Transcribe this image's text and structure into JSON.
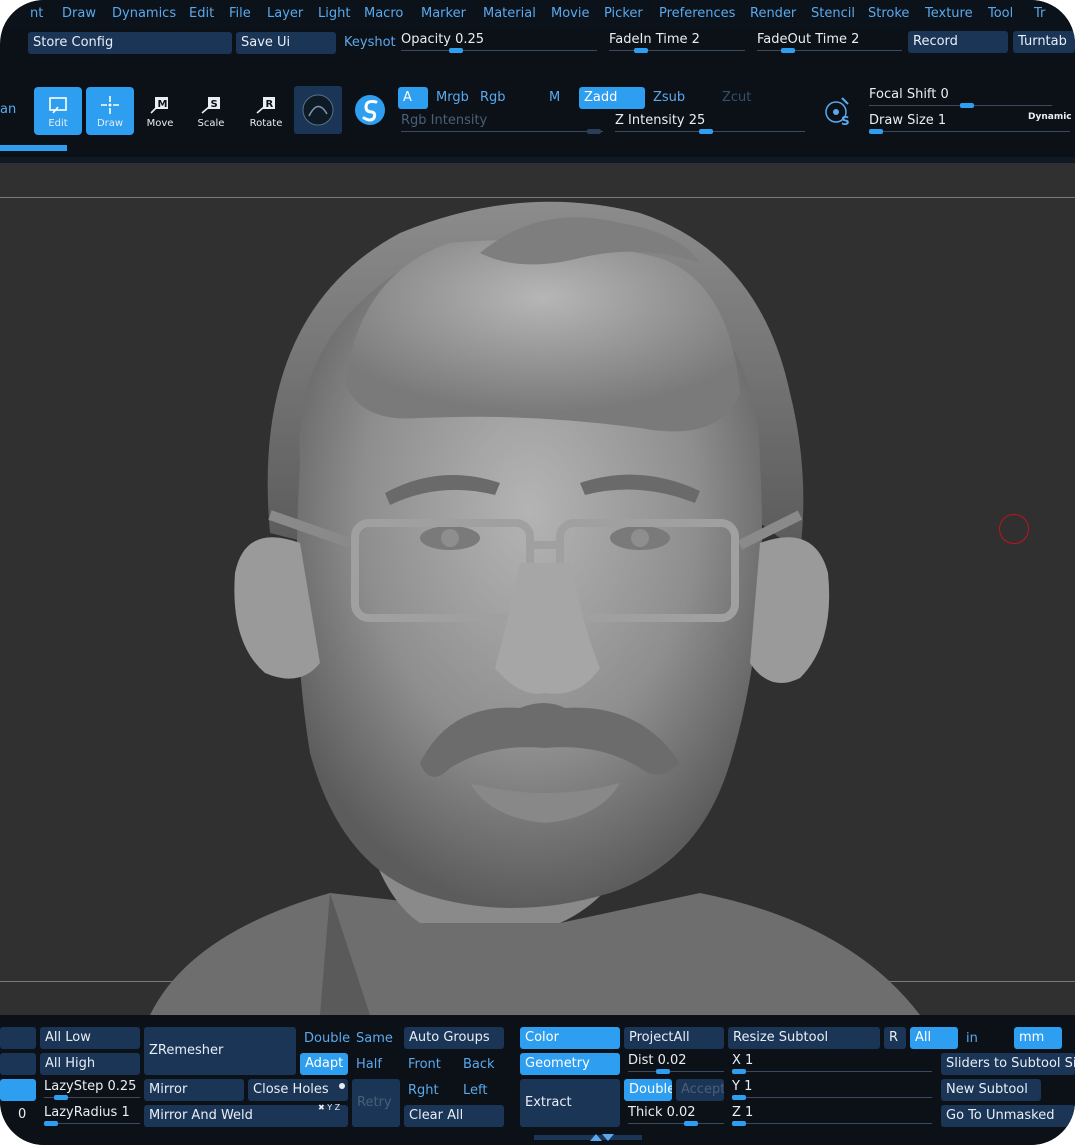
{
  "menu": [
    "nt",
    "Draw",
    "Dynamics",
    "Edit",
    "File",
    "Layer",
    "Light",
    "Macro",
    "Marker",
    "Material",
    "Movie",
    "Picker",
    "Preferences",
    "Render",
    "Stencil",
    "Stroke",
    "Texture",
    "Tool",
    "Tr"
  ],
  "row2": {
    "store_config": "Store Config",
    "save_ui": "Save Ui",
    "keyshot": "Keyshot",
    "opacity_label": "Opacity 0.25",
    "fadein_label": "FadeIn Time 2",
    "fadeout_label": "FadeOut Time 2",
    "record": "Record",
    "turntable": "Turntab"
  },
  "toolbar": {
    "left_cut": "an",
    "tools": [
      "Edit",
      "Draw",
      "Move",
      "Scale",
      "Rotate"
    ],
    "a": "A",
    "mrgb": "Mrgb",
    "rgb": "Rgb",
    "m": "M",
    "zadd": "Zadd",
    "zsub": "Zsub",
    "zcut": "Zcut",
    "rgb_intensity": "Rgb Intensity",
    "z_intensity": "Z Intensity 25",
    "focal_shift": "Focal Shift 0",
    "draw_size": "Draw Size 1",
    "dynamic": "Dynamic"
  },
  "values": {
    "opacity": 0.25,
    "z_intensity": 25,
    "focal_shift": 0,
    "draw_size": 1
  },
  "bottom": {
    "all_low": "All Low",
    "all_high": "All High",
    "lazystep": "LazyStep 0.25",
    "lazyradius": "LazyRadius 1",
    "left_cut_zero": "0",
    "zremesher": "ZRemesher",
    "double": "Double",
    "same": "Same",
    "adapt": "Adapt",
    "half": "Half",
    "mirror": "Mirror",
    "close_holes": "Close Holes",
    "mirror_and_weld": "Mirror And Weld",
    "retry": "Retry",
    "auto_groups": "Auto Groups",
    "front": "Front",
    "back": "Back",
    "rght": "Rght",
    "left": "Left",
    "clear_all": "Clear All",
    "color": "Color",
    "geometry": "Geometry",
    "extract": "Extract",
    "project_all": "ProjectAll",
    "dist": "Dist 0.02",
    "double2": "Double",
    "accept": "Accept",
    "thick": "Thick 0.02",
    "resize_subtool": "Resize Subtool",
    "r": "R",
    "all": "All",
    "in": "in",
    "mm": "mm",
    "x": "X 1",
    "y": "Y 1",
    "z": "Z 1",
    "sliders_to_subtool_size": "Sliders to Subtool Size",
    "new_subtool": "New Subtool",
    "go_to_unmasked": "Go To Unmasked"
  },
  "colors": {
    "accent": "#2d9ef0",
    "menu_text": "#5aa9ee",
    "button_bg": "#1b3556",
    "panel_bg": "#0c1118",
    "viewport_bg": "#303030",
    "cursor": "#c0141c"
  }
}
